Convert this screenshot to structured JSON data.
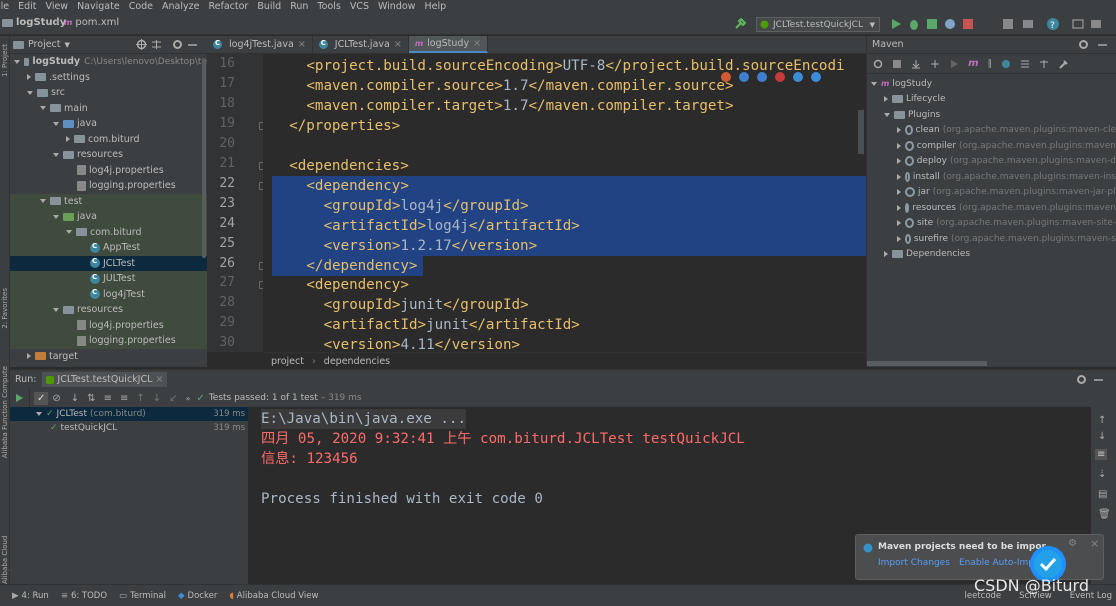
{
  "menu": [
    "ile",
    "Edit",
    "View",
    "Navigate",
    "Code",
    "Analyze",
    "Refactor",
    "Build",
    "Run",
    "Tools",
    "VCS",
    "Window",
    "Help"
  ],
  "nav": {
    "project": "logStudy",
    "file": "pom.xml",
    "run_config": "JCLTest.testQuickJCL"
  },
  "project_panel": {
    "title": "Project",
    "side_label": "1: Project",
    "tree": [
      {
        "text": "logStudy",
        "path": "C:\\Users\\lenovo\\Desktop\\te",
        "indent": 0,
        "icon": "folder",
        "open": true,
        "bold": true
      },
      {
        "text": ".settings",
        "indent": 1,
        "icon": "folder",
        "open": false
      },
      {
        "text": "src",
        "indent": 1,
        "icon": "folder",
        "open": true
      },
      {
        "text": "main",
        "indent": 2,
        "icon": "folder",
        "open": true
      },
      {
        "text": "java",
        "indent": 3,
        "icon": "folder-blue",
        "open": true
      },
      {
        "text": "com.biturd",
        "indent": 4,
        "icon": "package",
        "open": false
      },
      {
        "text": "resources",
        "indent": 3,
        "icon": "folder",
        "open": true
      },
      {
        "text": "log4j.properties",
        "indent": 4,
        "icon": "file"
      },
      {
        "text": "logging.properties",
        "indent": 4,
        "icon": "file"
      },
      {
        "text": "test",
        "indent": 2,
        "icon": "folder",
        "open": true
      },
      {
        "text": "java",
        "indent": 3,
        "icon": "folder-green",
        "open": true
      },
      {
        "text": "com.biturd",
        "indent": 4,
        "icon": "package",
        "open": true
      },
      {
        "text": "AppTest",
        "indent": 5,
        "icon": "class"
      },
      {
        "text": "JCLTest",
        "indent": 5,
        "icon": "class",
        "selected": true
      },
      {
        "text": "JULTest",
        "indent": 5,
        "icon": "class"
      },
      {
        "text": "log4jTest",
        "indent": 5,
        "icon": "class"
      },
      {
        "text": "resources",
        "indent": 3,
        "icon": "folder",
        "open": true
      },
      {
        "text": "log4j.properties",
        "indent": 4,
        "icon": "file"
      },
      {
        "text": "logging.properties",
        "indent": 4,
        "icon": "file"
      },
      {
        "text": "target",
        "indent": 1,
        "icon": "folder-orange",
        "open": false
      }
    ]
  },
  "tabs": [
    {
      "label": "log4jTest.java",
      "active": false
    },
    {
      "label": "JCLTest.java",
      "active": false
    },
    {
      "label": "logStudy",
      "active": true
    }
  ],
  "editor": {
    "lines": [
      {
        "n": "16",
        "indent": 2,
        "open": "<project.build.sourceEncoding>",
        "text": "UTF-8",
        "close": "</project.build.sourceEncodi"
      },
      {
        "n": "17",
        "indent": 2,
        "open": "<maven.compiler.source>",
        "text": "1.7",
        "close": "</maven.compiler.source>"
      },
      {
        "n": "18",
        "indent": 2,
        "open": "<maven.compiler.target>",
        "text": "1.7",
        "close": "</maven.compiler.target>"
      },
      {
        "n": "19",
        "indent": 1,
        "open": "</properties>",
        "text": "",
        "close": ""
      },
      {
        "n": "20",
        "indent": 0,
        "open": "",
        "text": "",
        "close": ""
      },
      {
        "n": "21",
        "indent": 1,
        "open": "<dependencies>",
        "text": "",
        "close": ""
      },
      {
        "n": "22",
        "indent": 2,
        "open": "<dependency>",
        "text": "",
        "close": "",
        "sel": true
      },
      {
        "n": "23",
        "indent": 3,
        "open": "<groupId>",
        "text": "log4j",
        "close": "</groupId>",
        "sel": true
      },
      {
        "n": "24",
        "indent": 3,
        "open": "<artifactId>",
        "text": "log4j",
        "close": "</artifactId>",
        "sel": true
      },
      {
        "n": "25",
        "indent": 3,
        "open": "<version>",
        "text": "1.2.17",
        "close": "</version>",
        "sel": true
      },
      {
        "n": "26",
        "indent": 2,
        "open": "</dependency>",
        "text": "",
        "close": "",
        "sel": true
      },
      {
        "n": "27",
        "indent": 2,
        "open": "<dependency>",
        "text": "",
        "close": ""
      },
      {
        "n": "28",
        "indent": 3,
        "open": "<groupId>",
        "text": "junit",
        "close": "</groupId>"
      },
      {
        "n": "29",
        "indent": 3,
        "open": "<artifactId>",
        "text": "junit",
        "close": "</artifactId>"
      },
      {
        "n": "30",
        "indent": 3,
        "open": "<version>",
        "text": "4.11",
        "close": "</version>"
      }
    ],
    "breadcrumb": [
      "project",
      "dependencies"
    ]
  },
  "maven": {
    "title": "Maven",
    "rows": [
      {
        "text": "logStudy",
        "extra": "",
        "indent": 0,
        "kind": "root"
      },
      {
        "text": "Lifecycle",
        "extra": "",
        "indent": 1,
        "kind": "folder"
      },
      {
        "text": "Plugins",
        "extra": "",
        "indent": 1,
        "kind": "folder-open"
      },
      {
        "text": "clean",
        "extra": "(org.apache.maven.plugins:maven-cle",
        "indent": 2,
        "kind": "plugin"
      },
      {
        "text": "compiler",
        "extra": "(org.apache.maven.plugins:maven",
        "indent": 2,
        "kind": "plugin"
      },
      {
        "text": "deploy",
        "extra": "(org.apache.maven.plugins:maven-d",
        "indent": 2,
        "kind": "plugin"
      },
      {
        "text": "install",
        "extra": "(org.apache.maven.plugins:maven-ins",
        "indent": 2,
        "kind": "plugin"
      },
      {
        "text": "jar",
        "extra": "(org.apache.maven.plugins:maven-jar-pl",
        "indent": 2,
        "kind": "plugin"
      },
      {
        "text": "resources",
        "extra": "(org.apache.maven.plugins:maven",
        "indent": 2,
        "kind": "plugin"
      },
      {
        "text": "site",
        "extra": "(org.apache.maven.plugins:maven-site-",
        "indent": 2,
        "kind": "plugin"
      },
      {
        "text": "surefire",
        "extra": "(org.apache.maven.plugins:maven-s",
        "indent": 2,
        "kind": "plugin"
      },
      {
        "text": "Dependencies",
        "extra": "",
        "indent": 1,
        "kind": "folder"
      }
    ]
  },
  "run": {
    "label": "Run:",
    "tab": "JCLTest.testQuickJCL",
    "status": "Tests passed:",
    "status_count": "1 of 1 test",
    "status_time": "– 319 ms",
    "tests": [
      {
        "name": "JCLTest",
        "pkg": "(com.biturd)",
        "time": "319 ms",
        "indent": 0
      },
      {
        "name": "testQuickJCL",
        "pkg": "",
        "time": "319 ms",
        "indent": 1
      }
    ],
    "console": [
      {
        "text": "E:\\Java\\bin\\java.exe ...",
        "color": "#a9b7c6",
        "hl": true
      },
      {
        "text": "四月 05, 2020 9:32:41 上午 com.biturd.JCLTest testQuickJCL",
        "color": "#ff6b68"
      },
      {
        "text": "信息: 123456",
        "color": "#ff6b68"
      },
      {
        "text": "",
        "color": "#a9b7c6"
      },
      {
        "text": "Process finished with exit code 0",
        "color": "#a9b7c6"
      }
    ]
  },
  "side_tools": [
    "2: Favorites",
    "Alibaba Function Compute",
    "Alibaba Cloud Explorer"
  ],
  "bottom_tools": [
    "4: Run",
    "6: TODO",
    "Terminal",
    "Docker",
    "Alibaba Cloud View"
  ],
  "bottom_right": [
    "leetcode",
    "SciView",
    "Event Log"
  ],
  "notification": {
    "title": "Maven projects need to be impor",
    "link1": "Import Changes",
    "link2": "Enable Auto-Imp"
  },
  "watermark": "CSDN @Biturd",
  "colors": {
    "tag": "#e8bf6a",
    "text": "#a9b7c6",
    "selection": "#214283",
    "error_text": "#ff6b68",
    "accent": "#4a88c7",
    "pass": "#499c54"
  }
}
